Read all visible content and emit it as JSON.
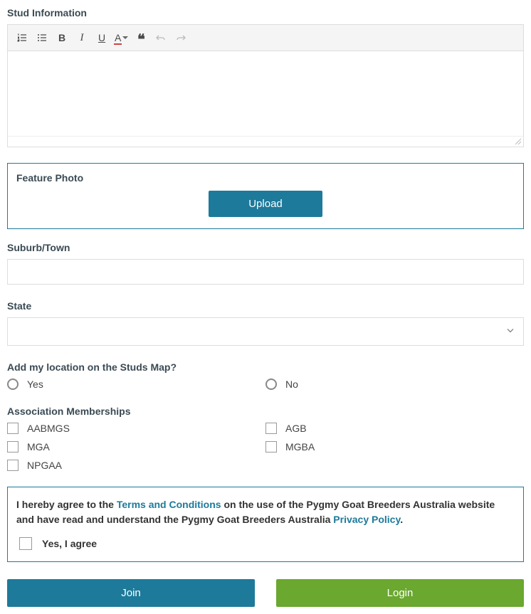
{
  "stud_info": {
    "label": "Stud Information"
  },
  "feature_photo": {
    "label": "Feature Photo",
    "upload_label": "Upload"
  },
  "suburb": {
    "label": "Suburb/Town",
    "value": ""
  },
  "state": {
    "label": "State",
    "value": ""
  },
  "studs_map": {
    "label": "Add my location on the Studs Map?",
    "options": {
      "yes": "Yes",
      "no": "No"
    }
  },
  "memberships": {
    "label": "Association Memberships",
    "options": {
      "aabmgs": "AABMGS",
      "agb": "AGB",
      "mga": "MGA",
      "mgba": "MGBA",
      "npgaa": "NPGAA"
    }
  },
  "agreement": {
    "text_parts": {
      "p1": "I hereby agree to the ",
      "terms_link": "Terms and Conditions",
      "p2": " on the use of the Pygmy Goat Breeders Australia website and have read and understand the Pygmy Goat Breeders Australia ",
      "privacy_link": "Privacy Policy",
      "p3": "."
    },
    "confirm_label": "Yes, I agree"
  },
  "buttons": {
    "join": "Join",
    "login": "Login"
  }
}
